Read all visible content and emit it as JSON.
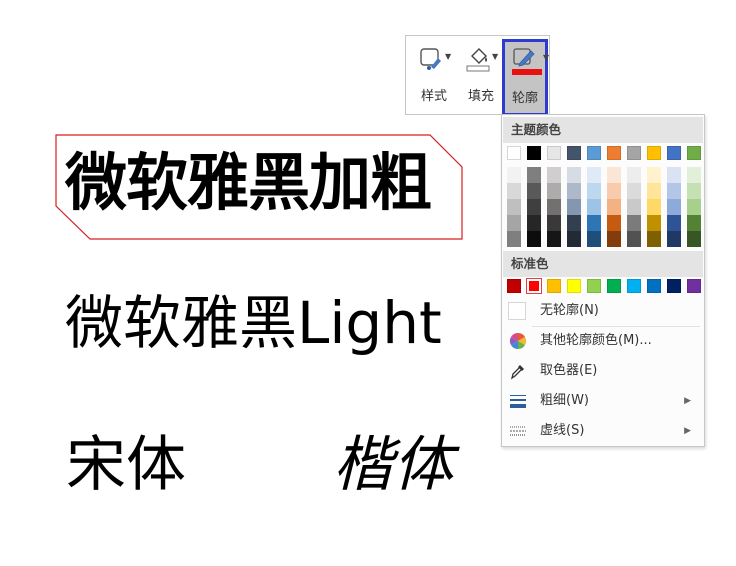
{
  "samples": {
    "bold": "微软雅黑加粗",
    "light": "微软雅黑Light",
    "song": "宋体",
    "kai": "楷体"
  },
  "toolbar": {
    "style_label": "样式",
    "fill_label": "填充",
    "outline_label": "轮廓"
  },
  "menu": {
    "theme_colors_header": "主题颜色",
    "standard_colors_header": "标准色",
    "theme_top_row": [
      "#ffffff",
      "#000000",
      "#e7e6e6",
      "#44546a",
      "#5b9bd5",
      "#ed7d31",
      "#a5a5a5",
      "#ffc000",
      "#4472c4",
      "#70ad47"
    ],
    "theme_shades": [
      [
        "#f2f2f2",
        "#7f7f7f",
        "#d0cece",
        "#d6dce4",
        "#deebf6",
        "#fbe5d5",
        "#ededed",
        "#fff2cc",
        "#dae3f3",
        "#e2efd9"
      ],
      [
        "#d8d8d8",
        "#595959",
        "#aeabab",
        "#adb9ca",
        "#bdd7ee",
        "#f7cbac",
        "#dbdbdb",
        "#fee599",
        "#b4c6e7",
        "#c5e0b3"
      ],
      [
        "#bfbfbf",
        "#3f3f3f",
        "#757070",
        "#8496b0",
        "#9dc3e6",
        "#f4b183",
        "#c9c9c9",
        "#ffd965",
        "#8eaadb",
        "#a8d08d"
      ],
      [
        "#a5a5a5",
        "#262626",
        "#3a3838",
        "#323f4f",
        "#2e75b5",
        "#c55a11",
        "#7b7b7b",
        "#bf9000",
        "#2f5496",
        "#538135"
      ],
      [
        "#7f7f7f",
        "#0c0c0c",
        "#171616",
        "#222a35",
        "#1e4e79",
        "#833c0b",
        "#525252",
        "#7f6000",
        "#1f3864",
        "#375623"
      ]
    ],
    "standard_colors": [
      "#c00000",
      "#ff0000",
      "#ffc000",
      "#ffff00",
      "#92d050",
      "#00b050",
      "#00b0f0",
      "#0070c0",
      "#002060",
      "#7030a0"
    ],
    "selected_standard_index": 1,
    "no_outline": "无轮廓(N)",
    "more_colors": "其他轮廓颜色(M)...",
    "eyedropper": "取色器(E)",
    "weight": "粗细(W)",
    "dashes": "虚线(S)"
  }
}
